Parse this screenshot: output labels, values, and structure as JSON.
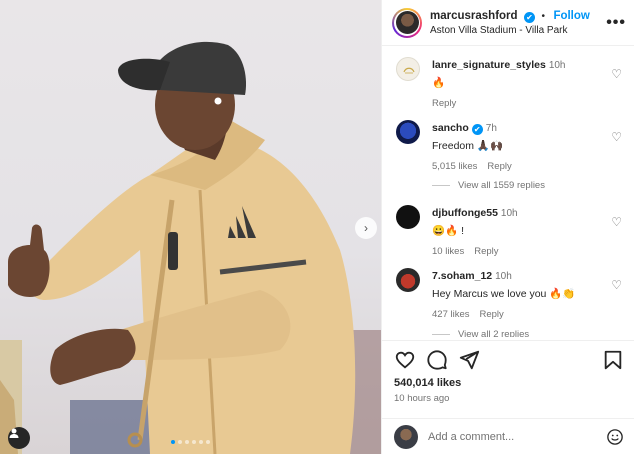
{
  "post": {
    "username": "marcusrashford",
    "verified_mark": "✔",
    "separator": "•",
    "follow_label": "Follow",
    "location": "Aston Villa Stadium - Villa Park",
    "more_label": "•••",
    "likes": "540,014 likes",
    "time_ago": "10 hours ago",
    "carousel_next": "›",
    "carousel_count": 6,
    "carousel_active": 1
  },
  "comments": [
    {
      "username": "lanre_signature_styles",
      "time": "10h",
      "text": "🔥",
      "likes": "",
      "reply": "Reply",
      "avatar_color": "#f3efe6"
    },
    {
      "username": "sancho",
      "verified": true,
      "time": "7h",
      "text": "Freedom 🙏🏿🙌🏿",
      "likes": "5,015 likes",
      "reply": "Reply",
      "avatar_color": "#1a2a6c"
    },
    {
      "username": "djbuffonge55",
      "time": "10h",
      "text": "😀🔥 !",
      "likes": "10 likes",
      "reply": "Reply",
      "avatar_color": "#111111"
    },
    {
      "username": "7.soham_12",
      "time": "10h",
      "text": "Hey Marcus we love you 🔥👏",
      "likes": "427 likes",
      "reply": "Reply",
      "avatar_color": "#c0392b"
    }
  ],
  "view_replies": [
    "View all 1559 replies",
    "View all 2 replies"
  ],
  "composer": {
    "placeholder": "Add a comment..."
  },
  "icons": {
    "like": "heart-icon",
    "comment": "comment-icon",
    "share": "share-icon",
    "save": "bookmark-icon",
    "emoji": "emoji-icon"
  },
  "colors": {
    "accent": "#0095f6",
    "muted": "#737373"
  }
}
